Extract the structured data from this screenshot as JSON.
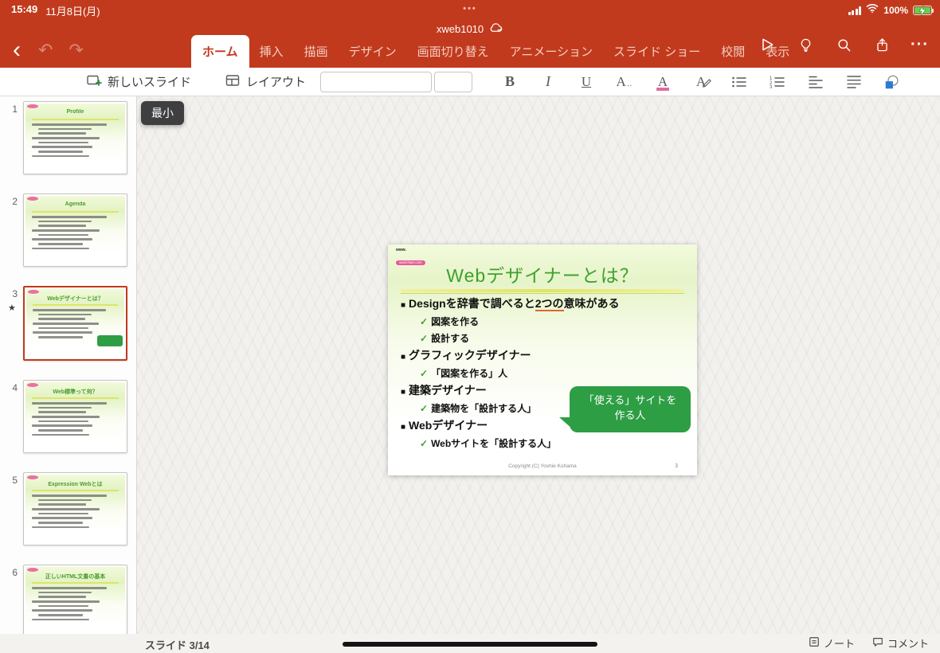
{
  "colors": {
    "accent": "#c23a1d",
    "slide_title_green": "#3fa12e",
    "bubble_green": "#2e9e44"
  },
  "status_bar": {
    "time": "15:49",
    "date": "11月8日(月)",
    "dots": "•••",
    "battery_percent": "100%"
  },
  "title_bar": {
    "filename": "xweb1010"
  },
  "ribbon": {
    "tabs": [
      {
        "label": "ホーム",
        "active": true
      },
      {
        "label": "挿入"
      },
      {
        "label": "描画"
      },
      {
        "label": "デザイン"
      },
      {
        "label": "画面切り替え"
      },
      {
        "label": "アニメーション"
      },
      {
        "label": "スライド ショー"
      },
      {
        "label": "校閲"
      },
      {
        "label": "表示"
      }
    ],
    "ellipsis": "···"
  },
  "toolbar": {
    "new_slide_label": "新しいスライド",
    "layout_label": "レイアウト",
    "font_name_value": "",
    "font_size_value": "",
    "bold_label": "B",
    "italic_label": "I",
    "underline_label": "U",
    "more_format_label": "A",
    "more_format_dots": "‥",
    "highlight_label": "A",
    "font_color_label": "A"
  },
  "tooltip": {
    "label": "最小"
  },
  "slides_panel": {
    "items": [
      {
        "number": "1",
        "title": "Profile"
      },
      {
        "number": "2",
        "title": "Agenda"
      },
      {
        "number": "3",
        "title": "Webデザイナーとは？"
      },
      {
        "number": "4",
        "title": "Web標準って何？"
      },
      {
        "number": "5",
        "title": "Expression Webとは"
      },
      {
        "number": "6",
        "title": "正しいHTML文書の基本"
      }
    ]
  },
  "slide": {
    "logo_line1": "www.",
    "logo_line2": "wanichan.com",
    "title": "Webデザイナーとは？",
    "b0_marker": "■",
    "b0_pre": "Designを辞書で調べると",
    "b0_underlined": "2つの",
    "b0_post": "意味がある",
    "bullets": [
      {
        "marker": "✓",
        "text": "図案を作る"
      },
      {
        "marker": "✓",
        "text": "設計する"
      },
      {
        "marker": "■",
        "text": "グラフィックデザイナー"
      },
      {
        "marker": "✓",
        "text": "「図案を作る」人"
      },
      {
        "marker": "■",
        "text": "建築デザイナー"
      },
      {
        "marker": "✓",
        "text": "建築物を「設計する人」"
      },
      {
        "marker": "■",
        "text": "Webデザイナー"
      },
      {
        "marker": "✓",
        "text": "Webサイトを「設計する人」"
      }
    ],
    "callout_line1": "「使える」サイトを",
    "callout_line2": "作る人",
    "footer": "Copyright (C) Yoshie Kohama",
    "page_number": "3"
  },
  "bottom_bar": {
    "slide_counter": "スライド 3/14",
    "notes_label": "ノート",
    "comments_label": "コメント"
  }
}
